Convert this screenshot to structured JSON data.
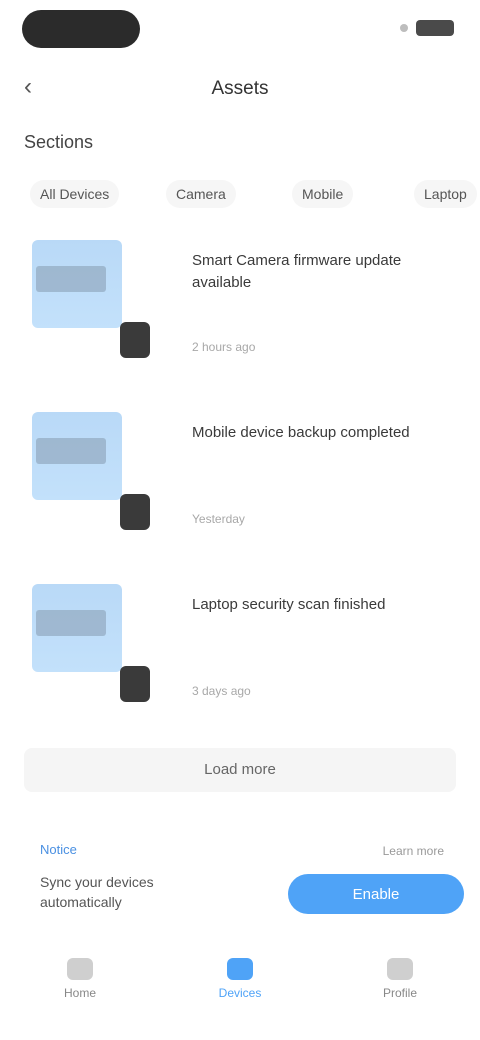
{
  "status_bar": {
    "time": "",
    "signal_icon": "signal-icon",
    "battery_icon": "battery-icon"
  },
  "nav": {
    "back_icon": "back-arrow-icon",
    "title": "Assets"
  },
  "section": {
    "title": "Sections"
  },
  "filters": [
    "All Devices",
    "Camera",
    "Mobile",
    "Laptop"
  ],
  "cards": [
    {
      "title": "Smart Camera firmware update available",
      "meta": "2 hours ago"
    },
    {
      "title": "Mobile device backup completed",
      "meta": "Yesterday"
    },
    {
      "title": "Laptop security scan finished",
      "meta": "3 days ago"
    }
  ],
  "load_more": "Load more",
  "promo": {
    "tag": "Notice",
    "text": "Sync your devices automatically",
    "meta": "Learn more",
    "button": "Enable"
  },
  "tabs": [
    {
      "label": "Home",
      "icon": "home-icon"
    },
    {
      "label": "Devices",
      "icon": "devices-icon",
      "active": true
    },
    {
      "label": "Profile",
      "icon": "profile-icon"
    }
  ],
  "colors": {
    "accent": "#4fa3f7",
    "thumb": "#b9d9f7"
  }
}
